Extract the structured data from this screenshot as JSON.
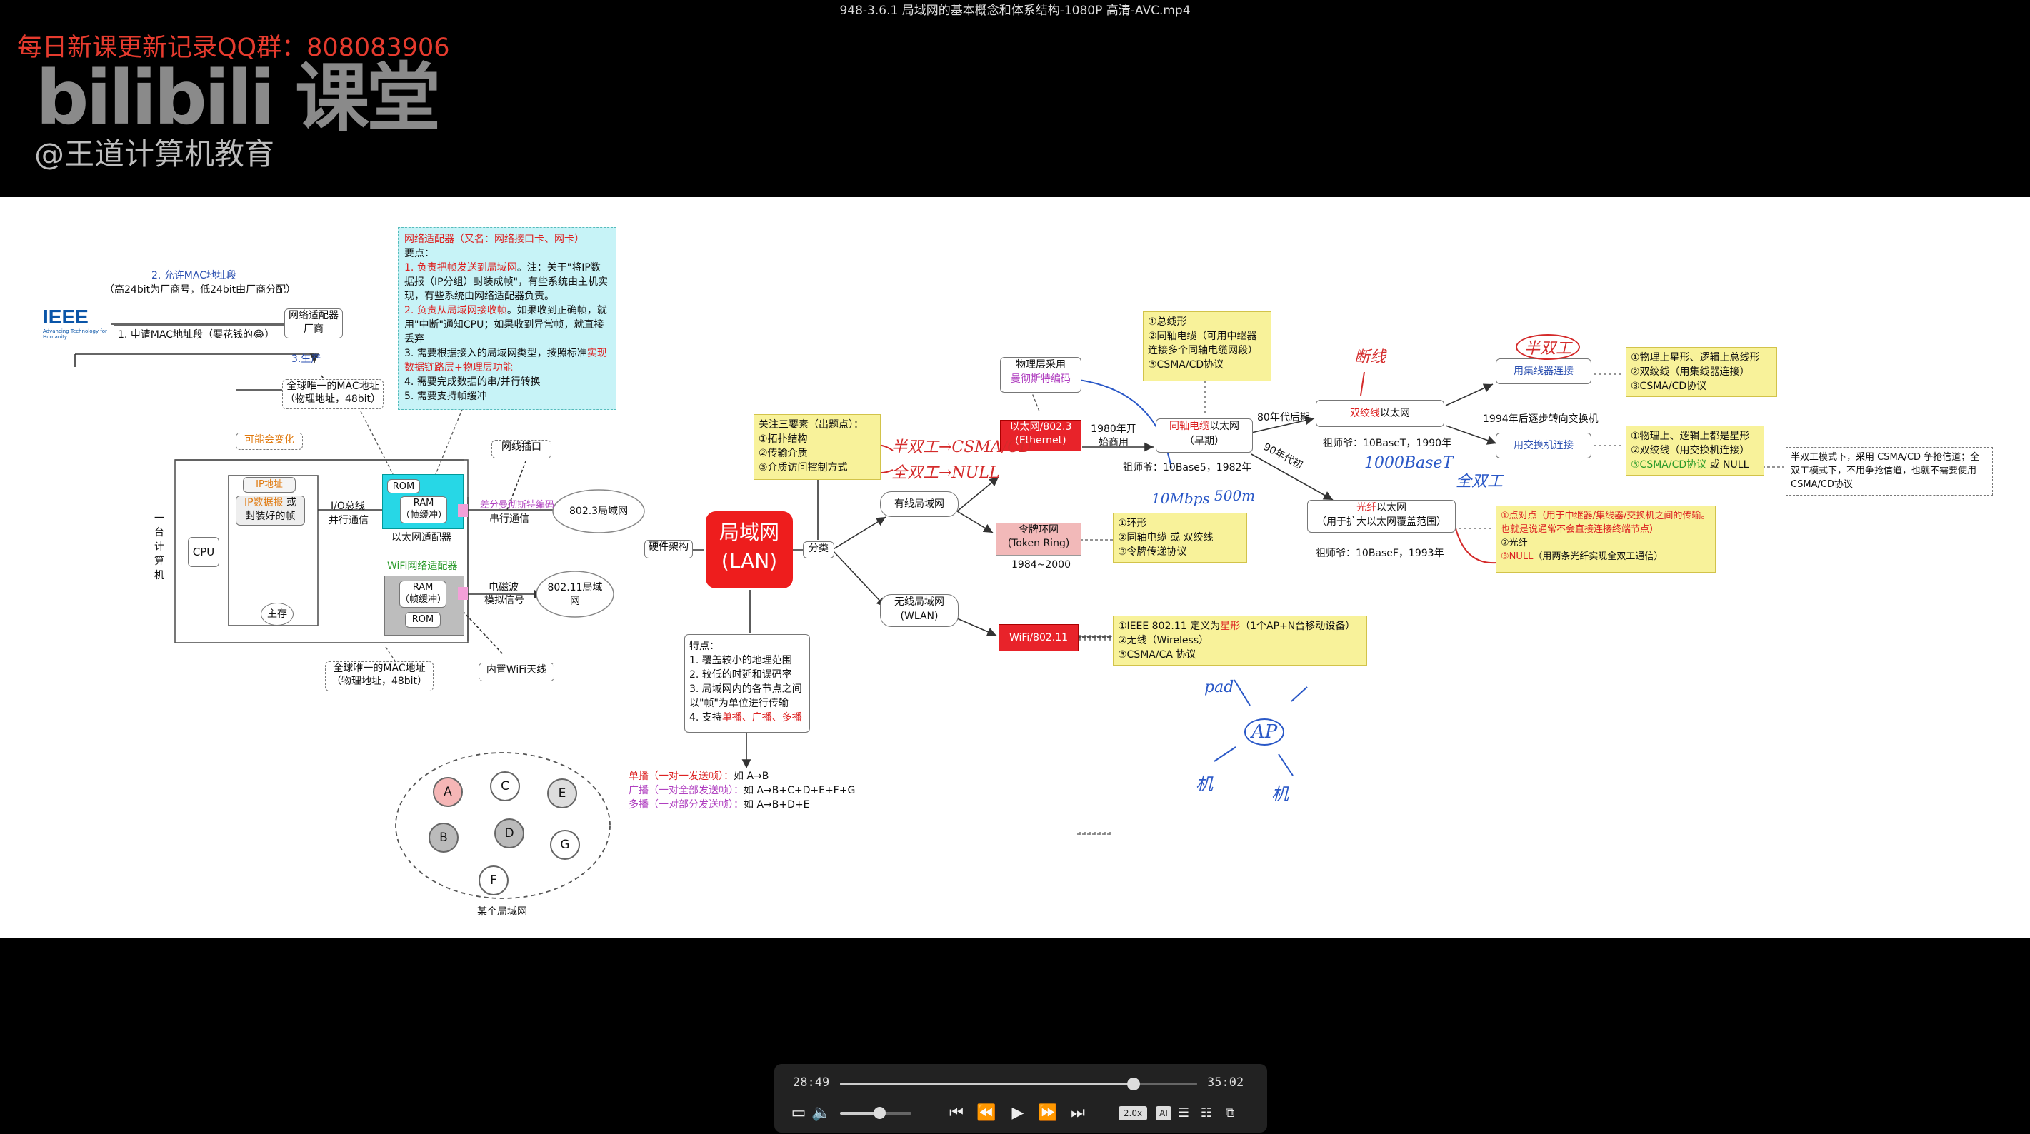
{
  "window": {
    "title": "948-3.6.1 局域网的基本概念和体系结构-1080P 高清-AVC.mp4"
  },
  "watermark": {
    "qq": "每日新课更新记录QQ群：808083906",
    "logo": "bilibili 课堂",
    "handle": "@王道计算机教育"
  },
  "slide": {
    "left": {
      "mac_allow": "2. 允许MAC地址段",
      "mac_alloc": "（高24bit为厂商号，低24bit由厂商分配）",
      "ieee": "IEEE",
      "ieee_tag": "Advancing Technology for Humanity",
      "apply": "1. 申请MAC地址段（要花钱的😂）",
      "adapter_maker": "网络适配器厂商",
      "produce": "3.生产",
      "mac_unique_top": "全球唯一的MAC地址",
      "mac_unique_top_sub": "（物理地址，48bit）",
      "may_change": "可能会变化",
      "ip_addr": "IP地址",
      "ip_packet": "IP数据报",
      "or": " 或 ",
      "framed": "封装好的帧",
      "io_bus": "I/O总线",
      "parallel": "并行通信",
      "cpu": "CPU",
      "memory": "主存",
      "side_label": "一台计算机",
      "rom": "ROM",
      "ram": "RAM",
      "buffer": "（帧缓冲）",
      "eth_adapter": "以太网适配器",
      "wifi_adapter": "WiFi网络适配器",
      "rom2": "ROM",
      "ram2": "RAM",
      "buffer2": "（帧缓冲）",
      "net_port": "网线插口",
      "encoding": "差分曼彻斯特编码",
      "serial": "串行通信",
      "lan8023": "802.3局域网",
      "em_wave": "电磁波",
      "analog": "模拟信号",
      "lan80211": "802.11局域网",
      "mac_unique_bottom": "全球唯一的MAC地址",
      "mac_unique_bottom_sub": "（物理地址，48bit）",
      "builtin_wifi": "内置WiFi天线"
    },
    "cyan": {
      "title": "网络适配器（又名：网络接口卡、网卡）",
      "key": "要点：",
      "p1a": "1. 负责把帧发送到局域网",
      "p1b": "。注：关于\"将IP数据报（IP分组）封装成帧\"，有些系统由主机实现，有些系统由网络适配器负责。",
      "p2a": "2. 负责从局域网接收帧",
      "p2b": "。如果收到正确帧，就用\"中断\"通知CPU；如果收到异常帧，就直接丢弃",
      "p3a": "3. 需要根据接入的局域网类型，按照标准",
      "p3b": "实现数据链路层+物理层功能",
      "p4": "4. 需要完成数据的串/并行转换",
      "p5": "5. 需要支持帧缓冲"
    },
    "center": {
      "three_title": "关注三要素（出题点）：",
      "three1": "①拓扑结构",
      "three2": "②传输介质",
      "three3": "③介质访问控制方式",
      "hw_arch": "硬件架构",
      "lan": "局域网",
      "lan_en": "(LAN)",
      "classify": "分类",
      "wired": "有线局域网",
      "wireless": "无线局域网",
      "wlan": "(WLAN)",
      "features": "特点：",
      "f1": "1. 覆盖较小的地理范围",
      "f2": "2. 较低的时延和误码率",
      "f3": "3. 局域网内的各节点之间以\"帧\"为单位进行传输",
      "f4a": "4. 支持",
      "f4b": "单播、广播、多播",
      "uni": "单播（一对一发送帧）：",
      "uni_ex": "如 A→B",
      "broad": "广播（一对全部发送帧）：",
      "broad_ex": "如 A→B+C+D+E+F+G",
      "multi": "多播（一对部分发送帧）：",
      "multi_ex": "如 A→B+D+E",
      "nodes": [
        "A",
        "C",
        "E",
        "B",
        "D",
        "G",
        "F"
      ],
      "area": "某个局域网"
    },
    "right": {
      "phys": "物理层采用",
      "manchester": "曼彻斯特编码",
      "ethernet": "以太网/802.3",
      "ethernet_en": "(Ethernet)",
      "commercial": "1980年开始商用",
      "bus1": "①总线形",
      "bus2": "②同轴电缆（可用中继器连接多个同轴电缆网段）",
      "bus3": "③CSMA/CD协议",
      "coax": "同轴电缆",
      "coax_b": "以太网",
      "early": "（早期）",
      "ancestor1": "祖师爷：10Base5，1982年",
      "token": "令牌环网",
      "token_en": "(Token Ring)",
      "token_years": "1984~2000",
      "ring1": "①环形",
      "ring2": "②同轴电缆 或 双绞线",
      "ring3": "③令牌传递协议",
      "wifi": "WiFi/802.11",
      "w1a": "①IEEE 802.11 定义为",
      "w1b": "星形",
      "w1c": "（1个AP+N台移动设备）",
      "w2": "②无线（Wireless）",
      "w3": "③CSMA/CA 协议",
      "late80": "80年代后期",
      "twisted": "双绞线",
      "twisted_b": "以太网",
      "ancestor2": "祖师爷：10BaseT，1990年",
      "s90": "90年代初",
      "fiber": "光纤",
      "fiber_b": "以太网",
      "fiber_sub": "（用于扩大以太网覆盖范围）",
      "ancestor3": "祖师爷：10BaseF，1993年",
      "p2p1": "①点对点（用于中继器/集线器/交换机之间的传输。也就是说通常不会直接连接终端节点）",
      "p2p2": "②光纤",
      "p2p3a": "③NULL",
      "p2p3b": "（用两条光纤实现全双工通信）",
      "hub": "用集线器连接",
      "hub1": "①物理上星形、逻辑上总线形",
      "hub2": "②双绞线（用集线器连接）",
      "hub3": "③CSMA/CD协议",
      "from1994": "1994年后逐步转向交换机",
      "switch": "用交换机连接",
      "sw1": "①物理上、逻辑上都是星形",
      "sw2": "②双绞线（用交换机连接）",
      "sw3a": "③CSMA/CD协议",
      "sw3b": " 或 NULL",
      "note": "半双工模式下，采用 CSMA/CD 争抢信道；全双工模式下，不用争抢信道，也就不需要使用CSMA/CD协议"
    },
    "hand": {
      "half_csma": "半双工→CSMA/CD",
      "full_null": "全双工→NULL",
      "broken": "断线",
      "half": "半双工",
      "mbps": "10Mbps",
      "m500": "500m",
      "base1000": "1000BaseT",
      "full": "全双工",
      "pad": "pad",
      "ap": "AP",
      "ji1": "机",
      "ji2": "机"
    }
  },
  "player": {
    "elapsed": "28:49",
    "total": "35:02",
    "progress": 0.822,
    "volume": 0.55,
    "speed": "2.0x",
    "ai": "AI"
  }
}
